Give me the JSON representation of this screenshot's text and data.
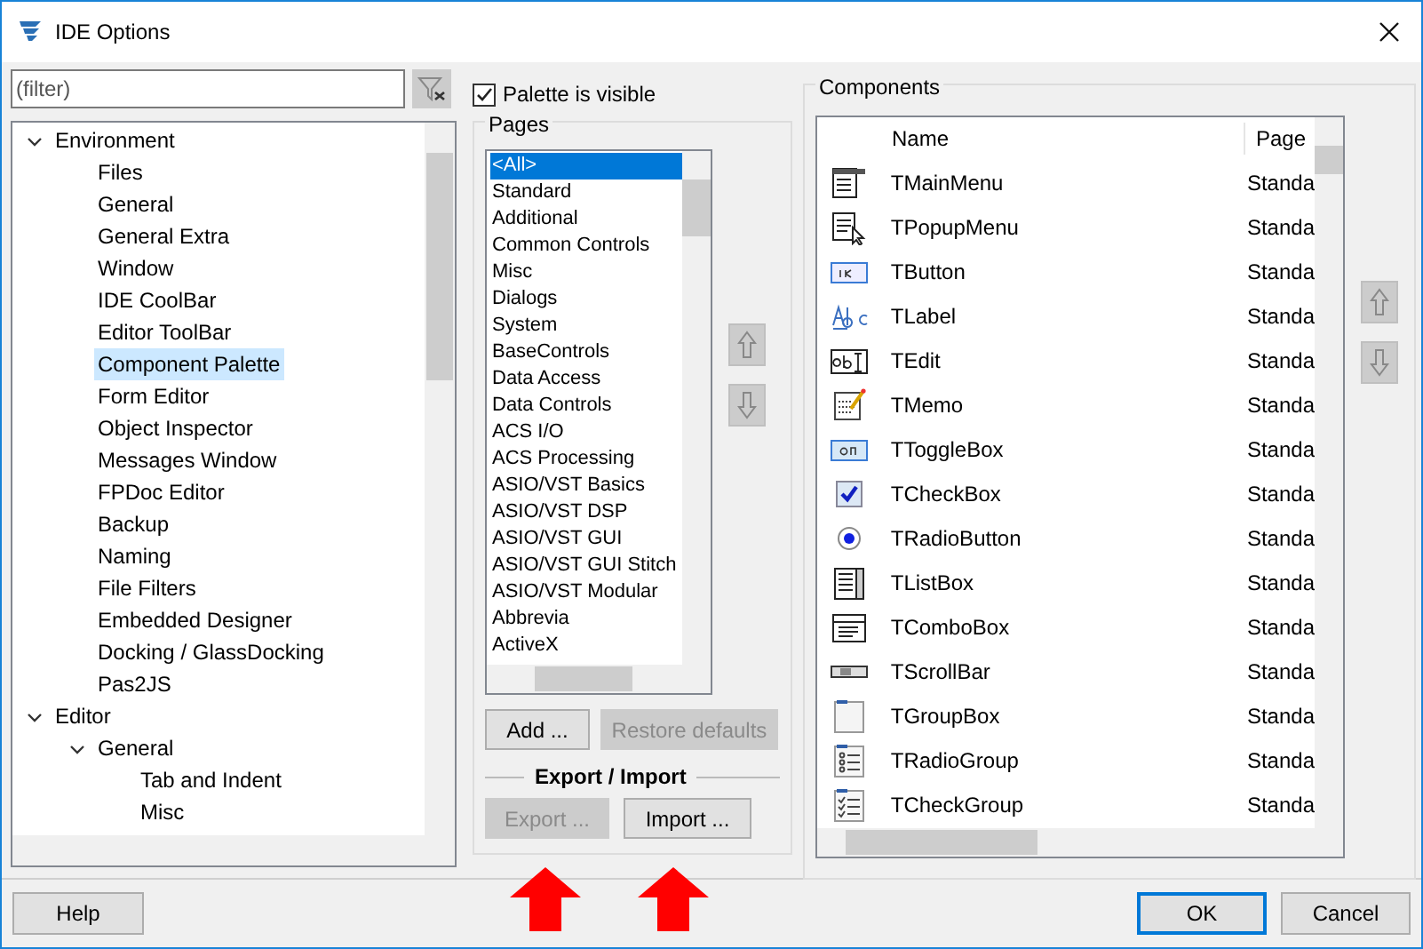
{
  "window": {
    "title": "IDE Options"
  },
  "filter": {
    "placeholder": "(filter)"
  },
  "tree": [
    {
      "label": "Environment",
      "expanded": true,
      "selected": false,
      "children": [
        {
          "label": "Files",
          "selected": false
        },
        {
          "label": "General",
          "selected": false
        },
        {
          "label": "General Extra",
          "selected": false
        },
        {
          "label": "Window",
          "selected": false
        },
        {
          "label": "IDE CoolBar",
          "selected": false
        },
        {
          "label": "Editor ToolBar",
          "selected": false
        },
        {
          "label": "Component Palette",
          "selected": true
        },
        {
          "label": "Form Editor",
          "selected": false
        },
        {
          "label": "Object Inspector",
          "selected": false
        },
        {
          "label": "Messages Window",
          "selected": false
        },
        {
          "label": "FPDoc Editor",
          "selected": false
        },
        {
          "label": "Backup",
          "selected": false
        },
        {
          "label": "Naming",
          "selected": false
        },
        {
          "label": "File Filters",
          "selected": false
        },
        {
          "label": "Embedded Designer",
          "selected": false
        },
        {
          "label": "Docking / GlassDocking",
          "selected": false
        },
        {
          "label": "Pas2JS",
          "selected": false
        }
      ]
    },
    {
      "label": "Editor",
      "expanded": true,
      "selected": false,
      "children": [
        {
          "label": "General",
          "expanded": true,
          "selected": false,
          "children": [
            {
              "label": "Tab and Indent",
              "selected": false
            },
            {
              "label": "Misc",
              "selected": false
            }
          ]
        }
      ]
    }
  ],
  "palette_visible": {
    "label": "Palette is visible",
    "checked": true
  },
  "pages": {
    "title": "Pages",
    "items": [
      {
        "label": "<All>",
        "selected": true
      },
      {
        "label": "Standard",
        "selected": false
      },
      {
        "label": "Additional",
        "selected": false
      },
      {
        "label": "Common Controls",
        "selected": false
      },
      {
        "label": "Misc",
        "selected": false
      },
      {
        "label": "Dialogs",
        "selected": false
      },
      {
        "label": "System",
        "selected": false
      },
      {
        "label": "BaseControls",
        "selected": false
      },
      {
        "label": "Data Access",
        "selected": false
      },
      {
        "label": "Data Controls",
        "selected": false
      },
      {
        "label": "ACS I/O",
        "selected": false
      },
      {
        "label": "ACS Processing",
        "selected": false
      },
      {
        "label": "ASIO/VST Basics",
        "selected": false
      },
      {
        "label": "ASIO/VST DSP",
        "selected": false
      },
      {
        "label": "ASIO/VST GUI",
        "selected": false
      },
      {
        "label": "ASIO/VST GUI Stitch",
        "selected": false
      },
      {
        "label": "ASIO/VST Modular",
        "selected": false
      },
      {
        "label": "Abbrevia",
        "selected": false
      },
      {
        "label": "ActiveX",
        "selected": false
      }
    ],
    "add_button": {
      "label": "Add ...",
      "disabled": false
    },
    "restore_button": {
      "label": "Restore defaults",
      "disabled": true
    }
  },
  "export_import": {
    "title": "Export / Import",
    "export_button": {
      "label": "Export ...",
      "disabled": true
    },
    "import_button": {
      "label": "Import ...",
      "disabled": false
    }
  },
  "components": {
    "title": "Components",
    "columns": [
      "Name",
      "Page"
    ],
    "rows": [
      {
        "kind": "mainmenu",
        "name": "TMainMenu",
        "page": "Standa"
      },
      {
        "kind": "popupmenu",
        "name": "TPopupMenu",
        "page": "Standa"
      },
      {
        "kind": "button",
        "name": "TButton",
        "page": "Standa"
      },
      {
        "kind": "label",
        "name": "TLabel",
        "page": "Standa"
      },
      {
        "kind": "edit",
        "name": "TEdit",
        "page": "Standa"
      },
      {
        "kind": "memo",
        "name": "TMemo",
        "page": "Standa"
      },
      {
        "kind": "toggle",
        "name": "TToggleBox",
        "page": "Standa"
      },
      {
        "kind": "checkbox",
        "name": "TCheckBox",
        "page": "Standa"
      },
      {
        "kind": "radio",
        "name": "TRadioButton",
        "page": "Standa"
      },
      {
        "kind": "listbox",
        "name": "TListBox",
        "page": "Standa"
      },
      {
        "kind": "combobox",
        "name": "TComboBox",
        "page": "Standa"
      },
      {
        "kind": "scrollbar",
        "name": "TScrollBar",
        "page": "Standa"
      },
      {
        "kind": "groupbox",
        "name": "TGroupBox",
        "page": "Standa"
      },
      {
        "kind": "radiogroup",
        "name": "TRadioGroup",
        "page": "Standa"
      },
      {
        "kind": "checkgroup",
        "name": "TCheckGroup",
        "page": "Standa"
      }
    ]
  },
  "footer": {
    "help": "Help",
    "ok": "OK",
    "cancel": "Cancel"
  }
}
